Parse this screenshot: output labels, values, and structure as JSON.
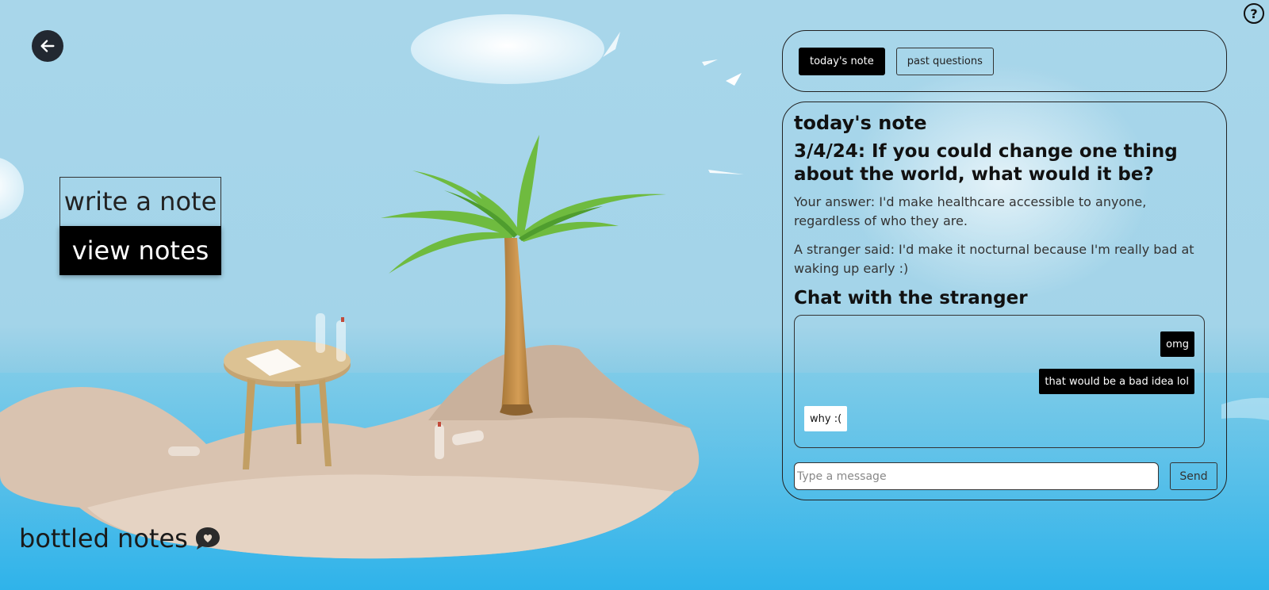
{
  "header": {
    "help_label": "?",
    "back_icon": "arrow-left-icon"
  },
  "menu": {
    "write_label": "write a note",
    "view_label": "view notes"
  },
  "brand": {
    "name": "bottled notes",
    "icon": "heart-speech-bubble-icon"
  },
  "tabs": {
    "today_label": "today's note",
    "past_label": "past questions"
  },
  "note": {
    "heading": "today's note",
    "question": "3/4/24: If you could change one thing about the world, what would it be?",
    "your_answer": "Your answer: I'd make healthcare accessible to anyone, regardless of who they are.",
    "stranger_answer": "A stranger said: I'd make it nocturnal because I'm really bad at waking up early :)"
  },
  "chat": {
    "heading": "Chat with the stranger",
    "messages": [
      {
        "from": "me",
        "text": "omg"
      },
      {
        "from": "me",
        "text": "that would be a bad idea lol"
      },
      {
        "from": "stranger",
        "text": "why :("
      }
    ],
    "input_placeholder": "Type a message",
    "send_label": "Send"
  },
  "colors": {
    "sky": "#a8d6ea",
    "sea": "#3cb6e8",
    "sand": "#d9c3b0",
    "accent": "#000000"
  }
}
